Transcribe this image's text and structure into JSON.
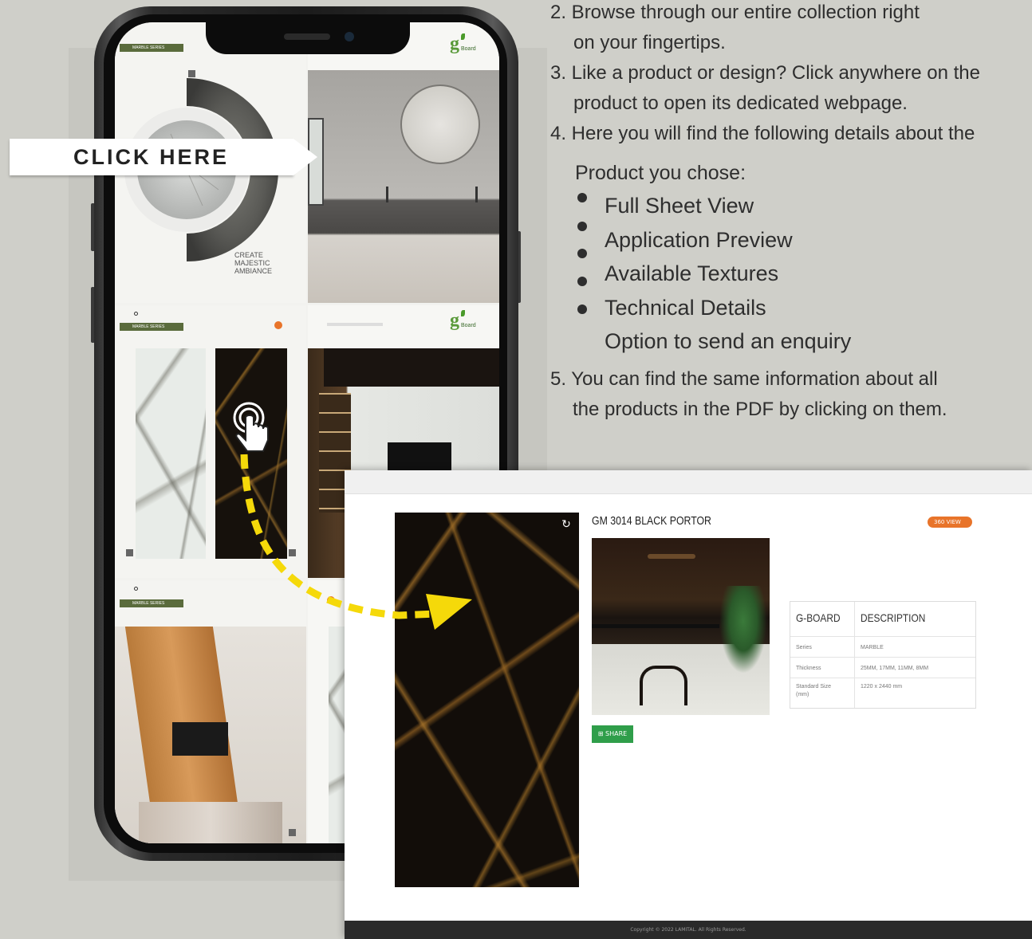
{
  "instructions": {
    "step2_line1": "2. Browse through our entire collection right",
    "step2_line2": "on your fingertips.",
    "step3_line1": "3. Like a product or design? Click anywhere on the",
    "step3_line2": "product to open its dedicated webpage.",
    "step4_line1": "4. Here you will find the following details about the",
    "step4_line2": "Product you chose:",
    "bullets": [
      "Full Sheet View",
      "Application Preview",
      "Available Textures",
      "Technical Details"
    ],
    "extra_line": "Option to send an enquiry",
    "step5_line1": "5. You can find the same information about all",
    "step5_line2": "the products in the PDF by clicking on them."
  },
  "callout": {
    "label": "CLICK HERE"
  },
  "catalog": {
    "series_tag": "MARBLE SERIES",
    "brand_logo_text": "Board",
    "hero_text": "CREATE MAJESTIC AMBIANCE"
  },
  "product_page": {
    "title": "GM 3014 BLACK PORTOR",
    "view_badge": "360 VIEW",
    "share_label": "SHARE",
    "rotate_icon": "rotate-icon",
    "table": {
      "header": [
        "G-BOARD",
        "DESCRIPTION"
      ],
      "rows": [
        [
          "Series",
          "MARBLE"
        ],
        [
          "Thickness",
          "25MM, 17MM, 11MM, 8MM"
        ],
        [
          "Standard Size (mm)",
          "1220 x 2440 mm"
        ]
      ]
    },
    "footer": "Copyright © 2022 LAMITAL. All Rights Reserved."
  },
  "colors": {
    "background": "#cfcfc9",
    "accent_green": "#2f9e4a",
    "accent_orange": "#e8742a",
    "arrow_yellow": "#f5d90a"
  }
}
